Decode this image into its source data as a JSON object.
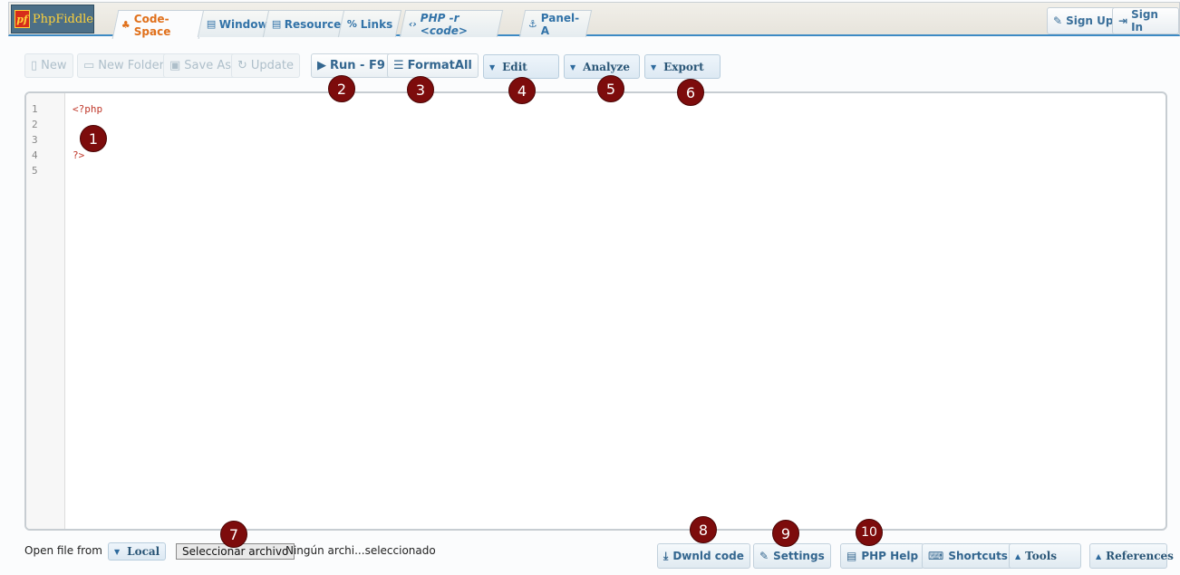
{
  "brand": {
    "logo_mark": "pf",
    "logo_text": "PhpFiddle"
  },
  "tabs": [
    {
      "label": "Code-Space",
      "icon": "code-icon",
      "glyph": "♣"
    },
    {
      "label": "Window",
      "icon": "window-icon",
      "glyph": "▤"
    },
    {
      "label": "Resources",
      "icon": "book-icon",
      "glyph": "▤"
    },
    {
      "label": "Links",
      "icon": "link-icon",
      "glyph": "%"
    },
    {
      "label": "PHP -r <code>",
      "icon": "code-brackets-icon",
      "glyph": "‹›"
    },
    {
      "label": "Panel-A",
      "icon": "anchor-icon",
      "glyph": "⚓"
    }
  ],
  "account": {
    "sign_up": "Sign Up",
    "sign_in": "Sign In",
    "sign_up_glyph": "✎",
    "sign_in_glyph": "⇥"
  },
  "toolbar": {
    "new": "New",
    "new_folder": "New Folder",
    "save_as": "Save As",
    "update": "Update",
    "run": "Run - F9",
    "format_all": "FormatAll",
    "edit": "Edit",
    "analyze": "Analyze",
    "export": "Export",
    "caret": "▼"
  },
  "editor": {
    "lines": [
      "1",
      "2",
      "3",
      "4",
      "5"
    ],
    "code": [
      "<?php",
      "",
      "",
      "?>",
      ""
    ]
  },
  "footer": {
    "open_label": "Open file from",
    "local": "Local",
    "file_button": "Seleccionar archivo",
    "file_status": "Ningún archi...seleccionado",
    "download": "Dwnld code",
    "settings": "Settings",
    "php_help": "PHP Help",
    "shortcuts": "Shortcuts",
    "tools": "Tools",
    "references": "References",
    "up_caret": "▲"
  },
  "markers": [
    "1",
    "2",
    "3",
    "4",
    "5",
    "6",
    "7",
    "8",
    "9",
    "10"
  ],
  "colors": {
    "accent": "#3d8ac4",
    "active_tab": "#e0701b",
    "marker": "#7d0c0c",
    "code_keyword": "#c0392b"
  }
}
